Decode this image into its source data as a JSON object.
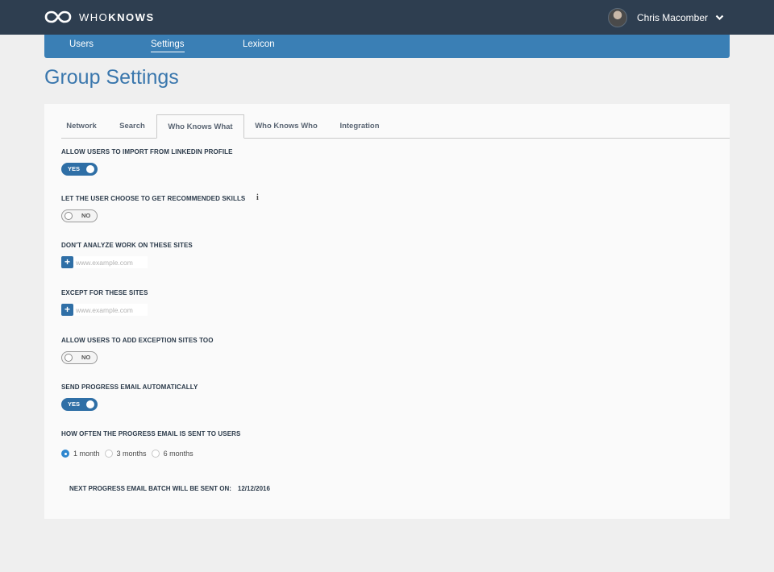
{
  "app": {
    "logo_light": "WHO",
    "logo_bold": "KNOWS",
    "user_name": "Chris Macomber"
  },
  "nav": {
    "items": [
      {
        "label": "Users"
      },
      {
        "label": "Settings",
        "active": true
      },
      {
        "label": "Lexicon"
      }
    ]
  },
  "page": {
    "title": "Group Settings"
  },
  "tabs": [
    {
      "label": "Network"
    },
    {
      "label": "Search"
    },
    {
      "label": "Who Knows What",
      "active": true
    },
    {
      "label": "Who Knows Who"
    },
    {
      "label": "Integration"
    }
  ],
  "settings": {
    "import_linkedin": {
      "label": "ALLOW USERS TO IMPORT FROM LINKEDIN PROFILE",
      "toggle": "YES",
      "on": true
    },
    "recommended_skills": {
      "label": "LET THE USER CHOOSE TO GET RECOMMENDED SKILLS",
      "toggle": "NO",
      "on": false
    },
    "dont_analyze": {
      "label": "DON'T ANALYZE WORK ON THESE SITES",
      "placeholder": "www.example.com"
    },
    "except_sites": {
      "label": "EXCEPT FOR THESE SITES",
      "placeholder": "www.example.com"
    },
    "exception_sites": {
      "label": "ALLOW USERS TO ADD EXCEPTION SITES TOO",
      "toggle": "NO",
      "on": false
    },
    "progress_email": {
      "label": "SEND PROGRESS EMAIL AUTOMATICALLY",
      "toggle": "YES",
      "on": true
    },
    "frequency": {
      "label": "HOW OFTEN THE PROGRESS EMAIL IS SENT TO USERS",
      "options": [
        {
          "label": "1 month",
          "checked": true
        },
        {
          "label": "3 months",
          "checked": false
        },
        {
          "label": "6 months",
          "checked": false
        }
      ]
    },
    "next_batch": {
      "label": "NEXT PROGRESS EMAIL BATCH WILL BE SENT ON:",
      "date": "12/12/2016"
    }
  },
  "icons": {
    "logo": "infinity-icon",
    "dropdown": "chevron-down-icon",
    "info": "info-icon",
    "add": "plus-icon"
  },
  "colors": {
    "topbar": "#2e3e50",
    "navbar": "#3a7fb5",
    "accent": "#2f6fa6",
    "title": "#3a77ad"
  }
}
